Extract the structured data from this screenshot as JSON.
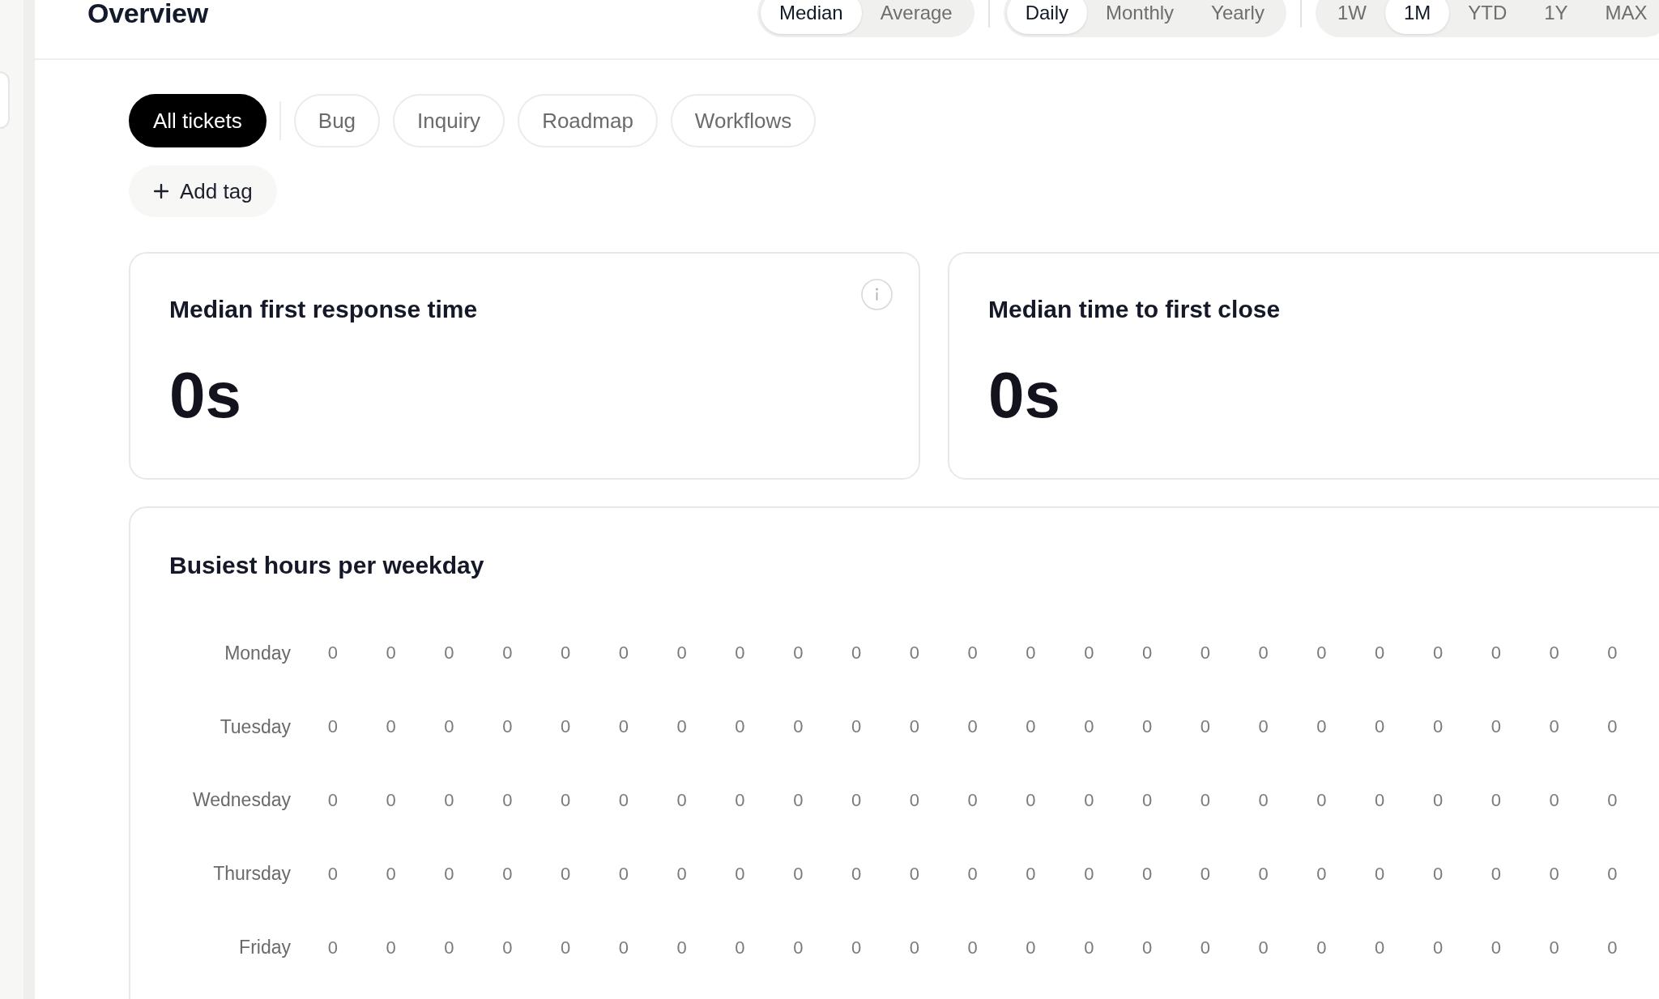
{
  "header": {
    "title": "Overview",
    "segment_groups": [
      {
        "options": [
          {
            "label": "Median",
            "selected": true
          },
          {
            "label": "Average",
            "selected": false
          }
        ]
      },
      {
        "options": [
          {
            "label": "Daily",
            "selected": true
          },
          {
            "label": "Monthly",
            "selected": false
          },
          {
            "label": "Yearly",
            "selected": false
          }
        ]
      },
      {
        "options": [
          {
            "label": "1W",
            "selected": false
          },
          {
            "label": "1M",
            "selected": true
          },
          {
            "label": "YTD",
            "selected": false
          },
          {
            "label": "1Y",
            "selected": false
          },
          {
            "label": "MAX",
            "selected": false
          }
        ]
      }
    ]
  },
  "tag_filters": [
    {
      "label": "All tickets",
      "selected": true
    },
    {
      "label": "Bug",
      "selected": false
    },
    {
      "label": "Inquiry",
      "selected": false
    },
    {
      "label": "Roadmap",
      "selected": false
    },
    {
      "label": "Workflows",
      "selected": false
    }
  ],
  "add_tag_button": {
    "label": "Add tag"
  },
  "metric_cards": [
    {
      "title": "Median first response time",
      "value": "0s",
      "info_icon": true
    },
    {
      "title": "Median time to first close",
      "value": "0s"
    }
  ],
  "heatmap": {
    "title": "Busiest hours per weekday",
    "rows": [
      {
        "day": "Monday",
        "values": [
          "0",
          "0",
          "0",
          "0",
          "0",
          "0",
          "0",
          "0",
          "0",
          "0",
          "0",
          "0",
          "0",
          "0",
          "0",
          "0",
          "0",
          "0",
          "0",
          "0",
          "0",
          "0",
          "0"
        ]
      },
      {
        "day": "Tuesday",
        "values": [
          "0",
          "0",
          "0",
          "0",
          "0",
          "0",
          "0",
          "0",
          "0",
          "0",
          "0",
          "0",
          "0",
          "0",
          "0",
          "0",
          "0",
          "0",
          "0",
          "0",
          "0",
          "0",
          "0"
        ]
      },
      {
        "day": "Wednesday",
        "values": [
          "0",
          "0",
          "0",
          "0",
          "0",
          "0",
          "0",
          "0",
          "0",
          "0",
          "0",
          "0",
          "0",
          "0",
          "0",
          "0",
          "0",
          "0",
          "0",
          "0",
          "0",
          "0",
          "0"
        ]
      },
      {
        "day": "Thursday",
        "values": [
          "0",
          "0",
          "0",
          "0",
          "0",
          "0",
          "0",
          "0",
          "0",
          "0",
          "0",
          "0",
          "0",
          "0",
          "0",
          "0",
          "0",
          "0",
          "0",
          "0",
          "0",
          "0",
          "0"
        ]
      },
      {
        "day": "Friday",
        "values": [
          "0",
          "0",
          "0",
          "0",
          "0",
          "0",
          "0",
          "0",
          "0",
          "0",
          "0",
          "0",
          "0",
          "0",
          "0",
          "0",
          "0",
          "0",
          "0",
          "0",
          "0",
          "0",
          "0"
        ]
      }
    ]
  }
}
